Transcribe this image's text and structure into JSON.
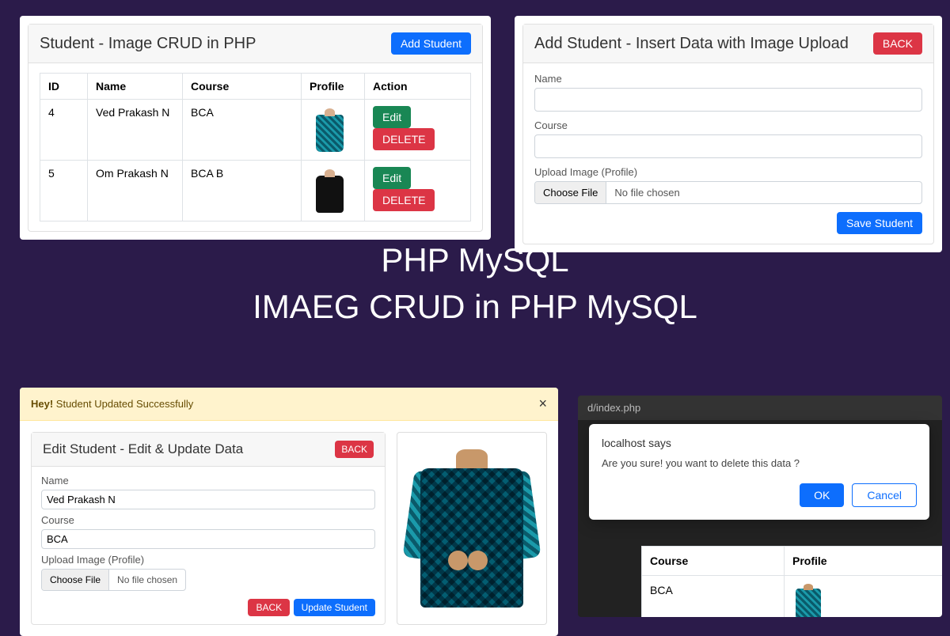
{
  "title_line1": "PHP MySQL",
  "title_line2": "IMAEG CRUD in PHP MySQL",
  "list_panel": {
    "title": "Student - Image CRUD in PHP",
    "add_btn": "Add Student",
    "cols": {
      "id": "ID",
      "name": "Name",
      "course": "Course",
      "profile": "Profile",
      "action": "Action"
    },
    "edit_btn": "Edit",
    "delete_btn": "DELETE",
    "rows": [
      {
        "id": "4",
        "name": "Ved Prakash N",
        "course": "BCA"
      },
      {
        "id": "5",
        "name": "Om Prakash N",
        "course": "BCA B"
      }
    ]
  },
  "add_panel": {
    "title": "Add Student - Insert Data with Image Upload",
    "back_btn": "BACK",
    "name_label": "Name",
    "course_label": "Course",
    "upload_label": "Upload Image (Profile)",
    "choose_file": "Choose File",
    "no_file": "No file chosen",
    "save_btn": "Save Student"
  },
  "edit_panel": {
    "alert_strong": "Hey!",
    "alert_text": " Student Updated Successfully",
    "title": "Edit Student - Edit & Update Data",
    "back_btn": "BACK",
    "name_label": "Name",
    "name_value": "Ved Prakash N",
    "course_label": "Course",
    "course_value": "BCA",
    "upload_label": "Upload Image (Profile)",
    "choose_file": "Choose File",
    "no_file": "No file chosen",
    "back_btn2": "BACK",
    "update_btn": "Update Student"
  },
  "confirm_panel": {
    "url": "d/index.php",
    "host": "localhost says",
    "msg": "Are you sure! you want to delete this data ?",
    "ok": "OK",
    "cancel": "Cancel",
    "col_course": "Course",
    "col_profile": "Profile",
    "row_course": "BCA"
  }
}
